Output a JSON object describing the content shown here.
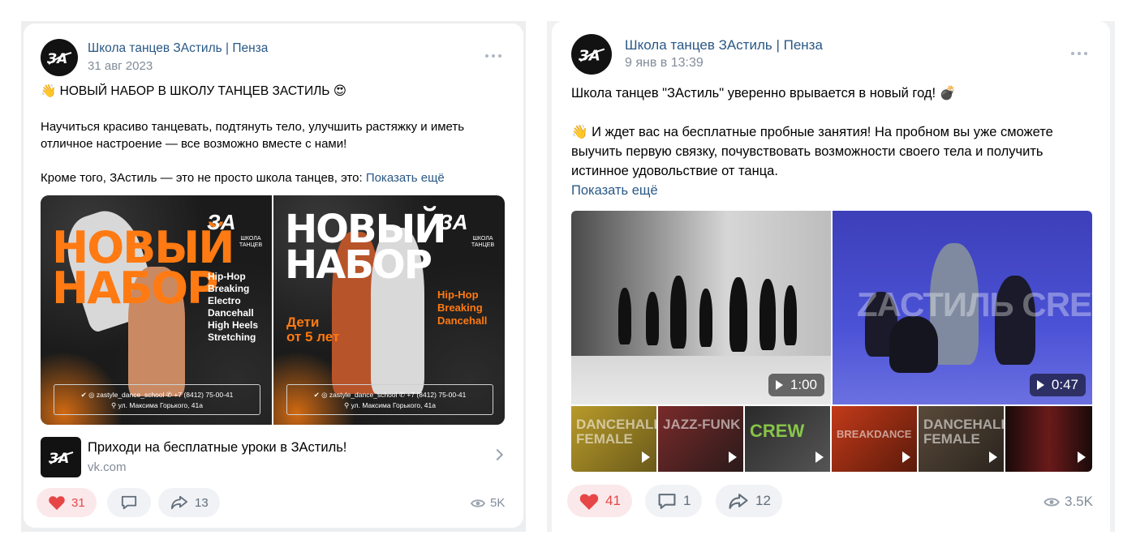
{
  "posts": [
    {
      "author": "Школа танцев ЗАстиль | Пенза",
      "date": "31 авг 2023",
      "headline_emoji": "👋",
      "headline": "НОВЫЙ НАБОР В ШКОЛУ ТАНЦЕВ ЗАСТИЛЬ",
      "headline_emoji_end": "😍",
      "paragraph1_line1": "Научиться красиво танцевать, подтянуть тело, улучшить растяжку и иметь",
      "paragraph1_line2": "отличное настроение — все возможно вместе с нами!",
      "paragraph2": "Кроме того, ЗАстиль — это не просто школа танцев, это: ",
      "show_more": "Показать ещё",
      "posters": [
        {
          "title_line1": "НОВЫЙ",
          "title_line2": "НАБОР",
          "styles": [
            "Hip-Hop",
            "Breaking",
            "Electro",
            "Dancehall",
            "High Heels",
            "Stretching"
          ],
          "contact_line1": "✔ ◎ zastyle_dance_school     ✆ +7 (8412) 75-00-41",
          "contact_line2": "⚲ ул. Максима Горького, 41а",
          "logo": "ЗА",
          "logo_sub": "ШКОЛА ТАНЦЕВ"
        },
        {
          "title_line1": "НОВЫЙ",
          "title_line2": "НАБОР",
          "kids_line1": "Дети",
          "kids_line2": "от 5 лет",
          "styles": [
            "Hip-Hop",
            "Breaking",
            "Dancehall"
          ],
          "contact_line1": "✔ ◎ zastyle_dance_school     ✆ +7 (8412) 75-00-41",
          "contact_line2": "⚲ ул. Максима Горького, 41а",
          "logo": "ЗА",
          "logo_sub": "ШКОЛА ТАНЦЕВ"
        }
      ],
      "link": {
        "title": "Приходи на бесплатные уроки в ЗАстиль!",
        "domain": "vk.com"
      },
      "likes": "31",
      "comments": "",
      "shares": "13",
      "views": "5K"
    },
    {
      "author": "Школа танцев ЗАстиль | Пенза",
      "date": "9 янв в 13:39",
      "line1": "Школа танцев \"ЗАстиль\" уверенно врывается в новый год! 💣",
      "line2": "👋 И ждет вас на бесплатные пробные занятия! На пробном вы уже сможете",
      "line3": "выучить первую связку, почувствовать возможности своего тела и получить",
      "line4": "истинное удовольствие от танца.",
      "show_more": "Показать ещё",
      "videos": [
        {
          "duration": "1:00"
        },
        {
          "duration": "0:47",
          "overlay_text": "ZАСТИЛЬ CREW"
        }
      ],
      "thumbs": [
        {
          "text": "DANCEHALL\nFEMALE"
        },
        {
          "text": "JAZZ-FUNK"
        },
        {
          "text": "CREW"
        },
        {
          "text": "BREAKDANCE"
        },
        {
          "text": "DANCEHALL\nFEMALE"
        },
        {
          "text": ""
        }
      ],
      "likes": "41",
      "comments": "1",
      "shares": "12",
      "views": "3.5K"
    }
  ],
  "colors": {
    "link": "#2a5885",
    "meta": "#818c99",
    "like": "#e64646",
    "accent_orange": "#ff7a12"
  }
}
